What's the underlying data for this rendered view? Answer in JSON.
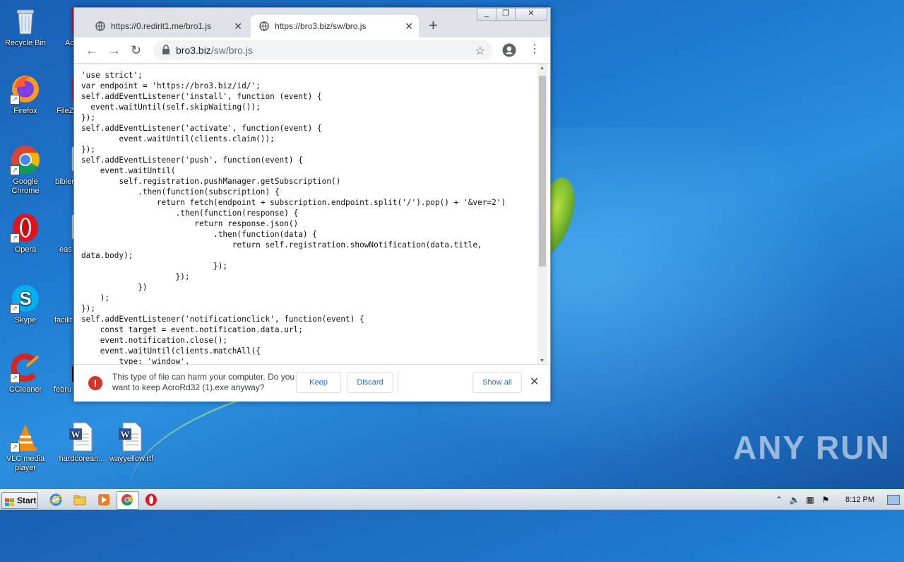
{
  "desktop": {
    "icons": [
      {
        "label": "Recycle Bin"
      },
      {
        "label": "Firefox"
      },
      {
        "label": "Google Chrome"
      },
      {
        "label": "Opera"
      },
      {
        "label": "Skype"
      },
      {
        "label": "CCleaner"
      },
      {
        "label": "VLC media player"
      },
      {
        "label": "Ac Rea"
      },
      {
        "label": "FileZi"
      },
      {
        "label": "bibler"
      },
      {
        "label": "eas"
      },
      {
        "label": "facilit"
      },
      {
        "label": "febru"
      },
      {
        "label": "hardcorean..."
      },
      {
        "label": "wayyellow.rtf"
      }
    ],
    "watermark": "ANY RUN"
  },
  "browser": {
    "tabs": [
      {
        "title": "https://0.redirit1.me/bro1.js",
        "active": false
      },
      {
        "title": "https://bro3.biz/sw/bro.js",
        "active": true
      }
    ],
    "new_tab_symbol": "+",
    "window_controls": {
      "minimize": "_",
      "restore": "❐",
      "close": "✕"
    },
    "address": {
      "host": "bro3.biz",
      "path": "/sw/bro.js"
    },
    "code": "'use strict';\nvar endpoint = 'https://bro3.biz/id/';\nself.addEventListener('install', function (event) {\n  event.waitUntil(self.skipWaiting());\n});\nself.addEventListener('activate', function(event) {\n        event.waitUntil(clients.claim());\n});\nself.addEventListener('push', function(event) {\n    event.waitUntil(\n        self.registration.pushManager.getSubscription()\n            .then(function(subscription) {\n                return fetch(endpoint + subscription.endpoint.split('/').pop() + '&ver=2')\n                    .then(function(response) {\n                        return response.json()\n                            .then(function(data) {\n                                return self.registration.showNotification(data.title,\ndata.body);\n                            });\n                    });\n            })\n    );\n});\nself.addEventListener('notificationclick', function(event) {\n    const target = event.notification.data.url;\n    event.notification.close();\n    event.waitUntil(clients.matchAll({\n        type: 'window',",
    "download_bar": {
      "warning_symbol": "!",
      "message": "This type of file can harm your computer. Do you want to keep AcroRd32 (1).exe anyway?",
      "keep_label": "Keep",
      "discard_label": "Discard",
      "show_all_label": "Show all",
      "close_symbol": "✕"
    }
  },
  "taskbar": {
    "start_label": "Start",
    "clock": "8:12 PM"
  },
  "colors": {
    "desktop_bg": "#1e7ad0",
    "tab_strip": "#dee1e6",
    "accent_blue": "#1a73e8",
    "warning_red": "#d93025"
  }
}
